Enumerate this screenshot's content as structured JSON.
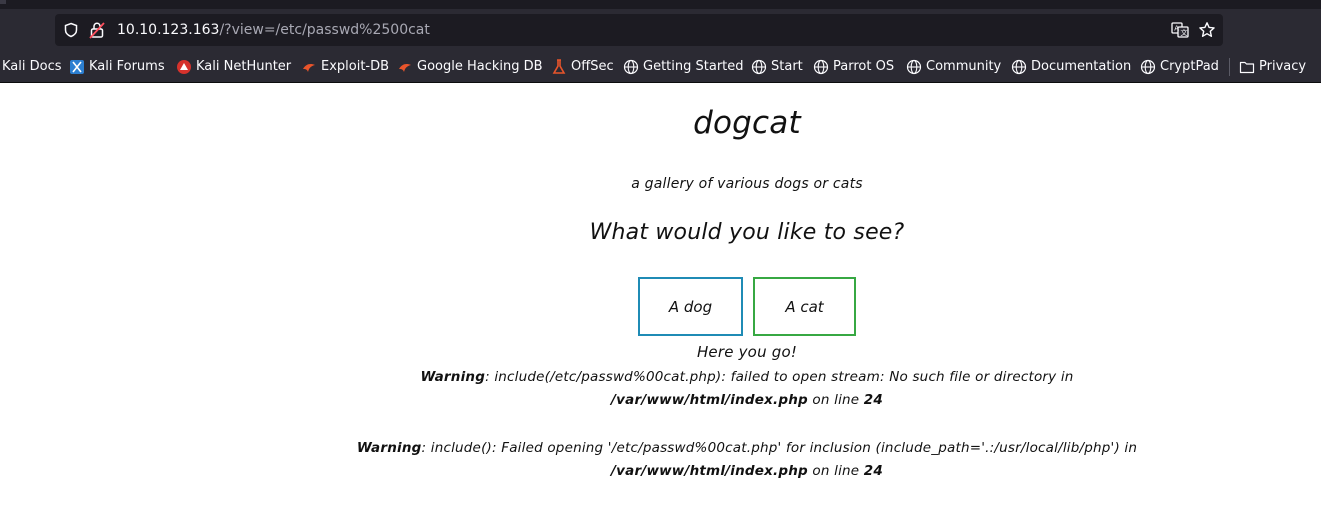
{
  "browser": {
    "url_host": "10.10.123.163",
    "url_path": "/?view=/etc/passwd%2500cat",
    "bookmarks": [
      {
        "label": "Kali Docs",
        "icon": "kali-docs-icon"
      },
      {
        "label": "Kali Forums",
        "icon": "kali-forums-icon"
      },
      {
        "label": "Kali NetHunter",
        "icon": "kali-nethunter-icon"
      },
      {
        "label": "Exploit-DB",
        "icon": "exploit-db-icon"
      },
      {
        "label": "Google Hacking DB",
        "icon": "google-hacking-db-icon"
      },
      {
        "label": "OffSec",
        "icon": "offsec-icon"
      },
      {
        "label": "Getting Started",
        "icon": "globe-icon"
      },
      {
        "label": "Start",
        "icon": "globe-icon"
      },
      {
        "label": "Parrot OS",
        "icon": "globe-icon"
      },
      {
        "label": "Community",
        "icon": "globe-icon"
      },
      {
        "label": "Documentation",
        "icon": "globe-icon"
      },
      {
        "label": "CryptPad",
        "icon": "globe-icon"
      },
      {
        "label": "Privacy",
        "icon": "folder-icon"
      }
    ]
  },
  "page": {
    "title": "dogcat",
    "tagline": "a gallery of various dogs or cats",
    "question": "What would you like to see?",
    "buttons": {
      "dog": "A dog",
      "cat": "A cat"
    },
    "result_text": "Here you go!",
    "warning_1": {
      "label": "Warning",
      "message": ": include(/etc/passwd%00cat.php): failed to open stream: No such file or directory in ",
      "file": "/var/www/html/index.php",
      "on_line": " on line ",
      "line": "24"
    },
    "warning_2": {
      "label": "Warning",
      "message": ": include(): Failed opening '/etc/passwd%00cat.php' for inclusion (include_path='.:/usr/local/lib/php') in ",
      "file": "/var/www/html/index.php",
      "on_line": " on line ",
      "line": "24"
    }
  },
  "colors": {
    "chrome_bg": "#2b2a33",
    "urlbar_bg": "#1c1b22",
    "dog_button_border": "#1f8bb5",
    "cat_button_border": "#37a843"
  }
}
